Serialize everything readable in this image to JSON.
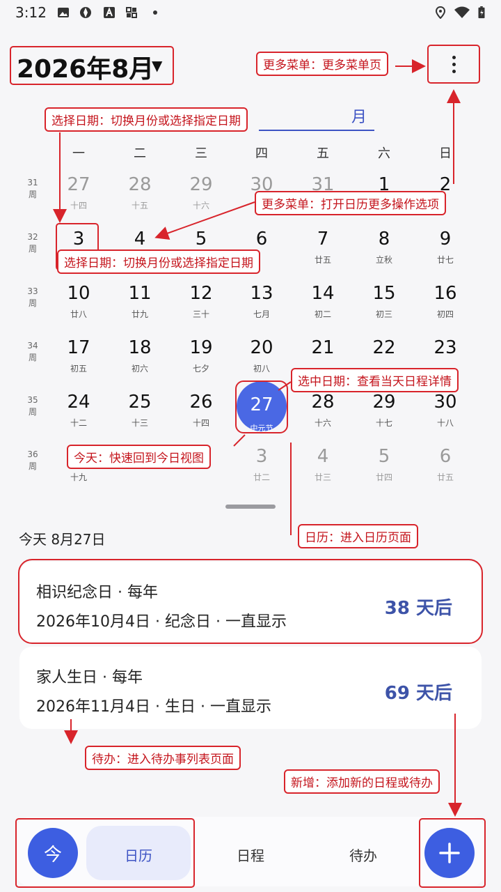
{
  "status_bar": {
    "time": "3:12",
    "icons_left": [
      "image-icon",
      "aperture-icon",
      "a-icon",
      "grid-icon",
      "dot-icon"
    ],
    "icons_right": [
      "location-icon",
      "wifi-icon",
      "battery-charging-icon"
    ]
  },
  "header": {
    "month_title": "2026年8月",
    "caret": "▼",
    "more_icon": "more-vertical-icon"
  },
  "view_tab": {
    "month": "月"
  },
  "weekdays": [
    "一",
    "二",
    "三",
    "四",
    "五",
    "六",
    "日"
  ],
  "weeks": [
    {
      "num": "31",
      "unit": "周",
      "days": [
        {
          "d": "27",
          "s": "十四",
          "other": true
        },
        {
          "d": "28",
          "s": "十五",
          "other": true
        },
        {
          "d": "29",
          "s": "十六",
          "other": true
        },
        {
          "d": "30",
          "s": "",
          "other": true
        },
        {
          "d": "31",
          "s": "",
          "other": true
        },
        {
          "d": "1",
          "s": "",
          "other": false
        },
        {
          "d": "2",
          "s": "",
          "other": false
        }
      ]
    },
    {
      "num": "32",
      "unit": "周",
      "days": [
        {
          "d": "3",
          "s": ""
        },
        {
          "d": "4",
          "s": ""
        },
        {
          "d": "5",
          "s": ""
        },
        {
          "d": "6",
          "s": ""
        },
        {
          "d": "7",
          "s": "廿五"
        },
        {
          "d": "8",
          "s": "立秋"
        },
        {
          "d": "9",
          "s": "廿七"
        }
      ]
    },
    {
      "num": "33",
      "unit": "周",
      "days": [
        {
          "d": "10",
          "s": "廿八"
        },
        {
          "d": "11",
          "s": "廿九"
        },
        {
          "d": "12",
          "s": "三十"
        },
        {
          "d": "13",
          "s": "七月"
        },
        {
          "d": "14",
          "s": "初二"
        },
        {
          "d": "15",
          "s": "初三"
        },
        {
          "d": "16",
          "s": "初四"
        }
      ]
    },
    {
      "num": "34",
      "unit": "周",
      "days": [
        {
          "d": "17",
          "s": "初五"
        },
        {
          "d": "18",
          "s": "初六"
        },
        {
          "d": "19",
          "s": "七夕"
        },
        {
          "d": "20",
          "s": "初八"
        },
        {
          "d": "21",
          "s": ""
        },
        {
          "d": "22",
          "s": ""
        },
        {
          "d": "23",
          "s": ""
        }
      ]
    },
    {
      "num": "35",
      "unit": "周",
      "days": [
        {
          "d": "24",
          "s": "十二"
        },
        {
          "d": "25",
          "s": "十三"
        },
        {
          "d": "26",
          "s": "十四"
        },
        {
          "d": "27",
          "s": "中元节",
          "today": true
        },
        {
          "d": "28",
          "s": "十六"
        },
        {
          "d": "29",
          "s": "十七"
        },
        {
          "d": "30",
          "s": "十八"
        }
      ]
    },
    {
      "num": "36",
      "unit": "周",
      "days": [
        {
          "d": "",
          "s": "十九"
        },
        {
          "d": "",
          "s": ""
        },
        {
          "d": "",
          "s": ""
        },
        {
          "d": "3",
          "s": "廿二",
          "other": true
        },
        {
          "d": "4",
          "s": "廿三",
          "other": true
        },
        {
          "d": "5",
          "s": "廿四",
          "other": true
        },
        {
          "d": "6",
          "s": "廿五",
          "other": true
        }
      ]
    }
  ],
  "today_section": {
    "label": "今天  8月27日"
  },
  "events": [
    {
      "title": "相识纪念日 · 每年",
      "detail": "2026年10月4日 · 纪念日 · 一直显示",
      "days": "38 天后"
    },
    {
      "title": "家人生日 · 每年",
      "detail": "2026年11月4日 · 生日 · 一直显示",
      "days": "69 天后"
    }
  ],
  "bottom_nav": {
    "today_button": "今",
    "tabs": [
      "日历",
      "日程",
      "待办"
    ],
    "add_icon": "plus-icon"
  },
  "annotations": {
    "more_menu_top": "更多菜单：更多菜单页",
    "select_date_top": "选择日期：切换月份或选择指定日期",
    "more_menu_mid": "更多菜单：打开日历更多操作选项",
    "select_date_mid": "选择日期：切换月份或选择指定日期",
    "selected_date": "选中日期：查看当天日程详情",
    "today": "今天：快速回到今日视图",
    "calendar": "日历：进入日历页面",
    "todo": "待办：进入待办事列表页面",
    "add": "新增：添加新的日程或待办"
  },
  "colors": {
    "accent": "#3d5ee1",
    "today_circle": "#4a68e4",
    "annotation_red": "#d8242b",
    "days_until": "#3d53a8"
  }
}
